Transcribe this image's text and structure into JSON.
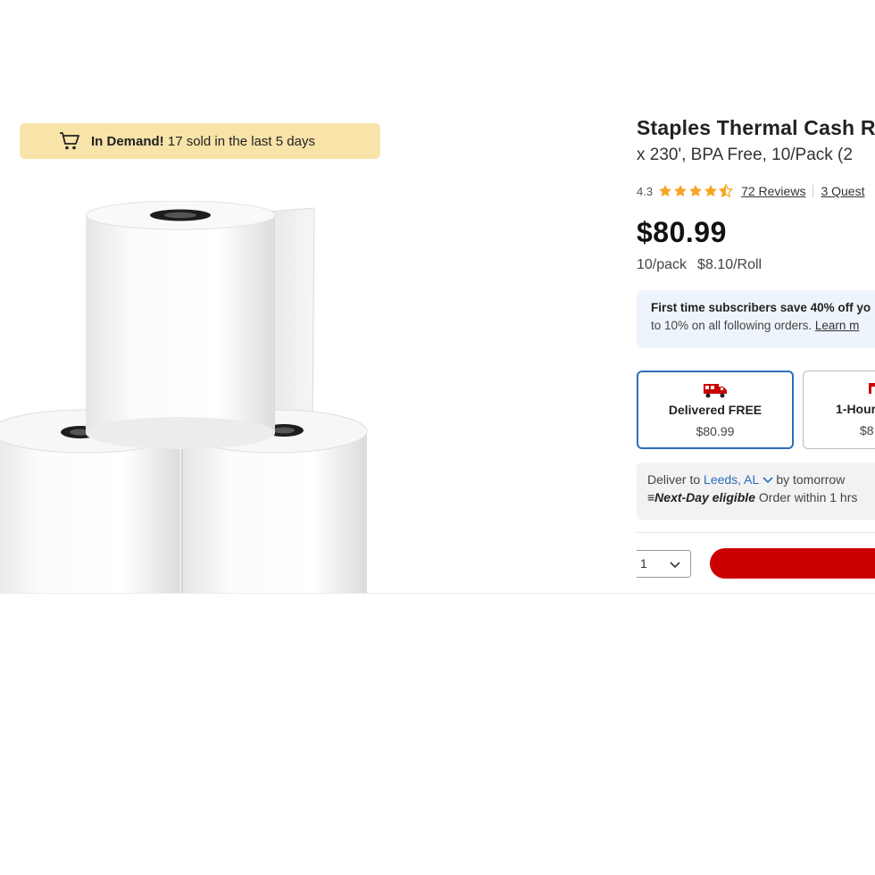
{
  "demand_banner": {
    "icon": "cart-icon",
    "bold": "In Demand!",
    "text": "17 sold in the last 5 days"
  },
  "product": {
    "title": "Staples Thermal Cash R",
    "subtitle": "x 230', BPA Free, 10/Pack (2",
    "rating_value": "4.3",
    "rating_stars": 4.3,
    "reviews_label": "72 Reviews",
    "questions_label": "3 Quest",
    "price": "$80.99",
    "pack": "10/pack",
    "per_roll": "$8.10/Roll"
  },
  "promo": {
    "line1": "First time subscribers save 40% off yo",
    "line2_text": "to 10% on all following orders.",
    "line2_link": "Learn m"
  },
  "fulfillment": {
    "options": [
      {
        "label": "Delivered FREE",
        "price": "$80.99",
        "icon": "delivery-truck-icon",
        "selected": true
      },
      {
        "label": "1-Hour",
        "price": "$8",
        "icon": "store-icon",
        "selected": false
      }
    ]
  },
  "delivery": {
    "prefix": "Deliver to",
    "location": "Leeds, AL",
    "suffix": "by tomorrow",
    "next_day": "Next-Day eligible",
    "order_within": "Order within 1 hrs"
  },
  "cart": {
    "quantity": "1"
  },
  "colors": {
    "banner": "#f8e3a8",
    "star": "#f5a623",
    "accent_blue": "#2a6ebb",
    "brand_red": "#cc0000"
  }
}
